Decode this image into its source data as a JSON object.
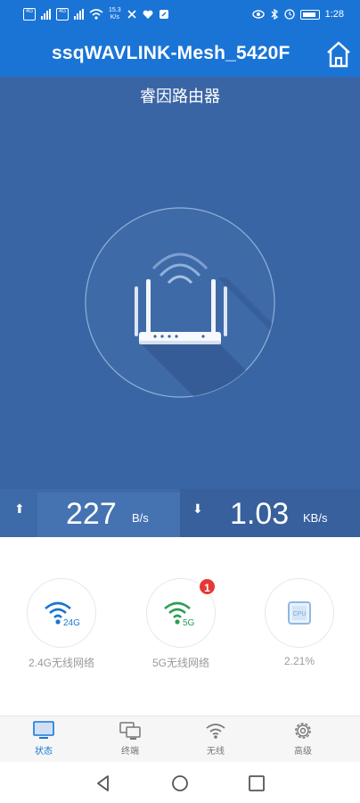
{
  "status_bar": {
    "sim1": "4G",
    "sim2": "4G",
    "net_speed": "15.3",
    "net_speed_unit": "K/s",
    "battery_text": "",
    "time": "1:28"
  },
  "header": {
    "title": "ssqWAVLINK-Mesh_5420F",
    "home_icon": "home-icon"
  },
  "hero": {
    "router_name": "睿因路由器",
    "upload": {
      "value": "227",
      "unit": "B/s"
    },
    "download": {
      "value": "1.03",
      "unit": "KB/s"
    }
  },
  "tiles": [
    {
      "label": "2.4G无线网络",
      "icon_text": "24G",
      "icon": "wifi-icon",
      "color": "#1a74d6"
    },
    {
      "label": "5G无线网络",
      "icon_text": "5G",
      "icon": "wifi-icon",
      "color": "#2e9d57",
      "badge": "1"
    },
    {
      "label": "2.21%",
      "icon_text": "CPU",
      "icon": "cpu-icon",
      "color": "#8fb7e6"
    }
  ],
  "tabs": [
    {
      "label": "状态",
      "icon": "monitor-icon",
      "active": true
    },
    {
      "label": "终端",
      "icon": "devices-icon",
      "active": false
    },
    {
      "label": "无线",
      "icon": "wifi-icon",
      "active": false
    },
    {
      "label": "高级",
      "icon": "gear-icon",
      "active": false
    }
  ],
  "colors": {
    "primary": "#1a74d6",
    "hero_bg": "#3a65a5",
    "badge": "#e53935",
    "wifi5g": "#2e9d57"
  }
}
